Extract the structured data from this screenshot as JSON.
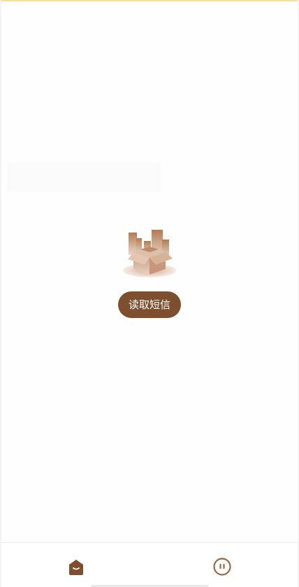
{
  "empty_state": {
    "illustration_icon": "empty-box-city-icon",
    "button_label": "读取短信"
  },
  "tab_bar": {
    "tabs": [
      {
        "icon": "home-icon",
        "active": true
      },
      {
        "icon": "profile-face-icon",
        "active": false
      }
    ]
  },
  "colors": {
    "accent": "#7d4f2e",
    "top_bar": "#f8dca0"
  }
}
